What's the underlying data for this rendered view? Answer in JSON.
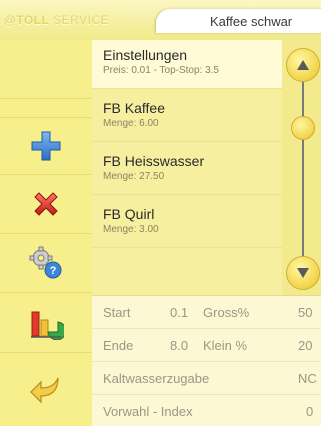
{
  "header": {
    "brand_part1": "@TOLL",
    "brand_part2": "SERVICE",
    "product_title": "Kaffee schwar"
  },
  "toolbar": {
    "tools": [
      {
        "name": "add-icon",
        "color": "#3a86d8"
      },
      {
        "name": "delete-icon",
        "color": "#d8302a"
      },
      {
        "name": "settings-help-icon",
        "color": "#4a90e2"
      },
      {
        "name": "statistics-chart-icon",
        "color": "#e23a2a"
      },
      {
        "name": "back-arrow-icon",
        "color": "#f0c23a"
      }
    ]
  },
  "list": {
    "items": [
      {
        "title": "Einstellungen",
        "subtitle": "Preis: 0.01 - Top-Stop: 3.5",
        "selected": true
      },
      {
        "title": "FB Kaffee",
        "subtitle": "Menge: 6.00",
        "selected": false
      },
      {
        "title": "FB Heisswasser",
        "subtitle": "Menge: 27.50",
        "selected": false
      },
      {
        "title": "FB Quirl",
        "subtitle": "Menge: 3.00",
        "selected": false
      }
    ]
  },
  "scrollbar": {
    "up_icon": "up-arrow-icon",
    "down_icon": "down-arrow-icon"
  },
  "params": {
    "row1": {
      "label1": "Start",
      "value1": "0.1",
      "label2": "Gross%",
      "value2": "50"
    },
    "row2": {
      "label1": "Ende",
      "value1": "8.0",
      "label2": "Klein %",
      "value2": "20"
    },
    "row3": {
      "label": "Kaltwasserzugabe",
      "value": "NC"
    },
    "row4": {
      "label": "Vorwahl - Index",
      "value": "0"
    }
  }
}
